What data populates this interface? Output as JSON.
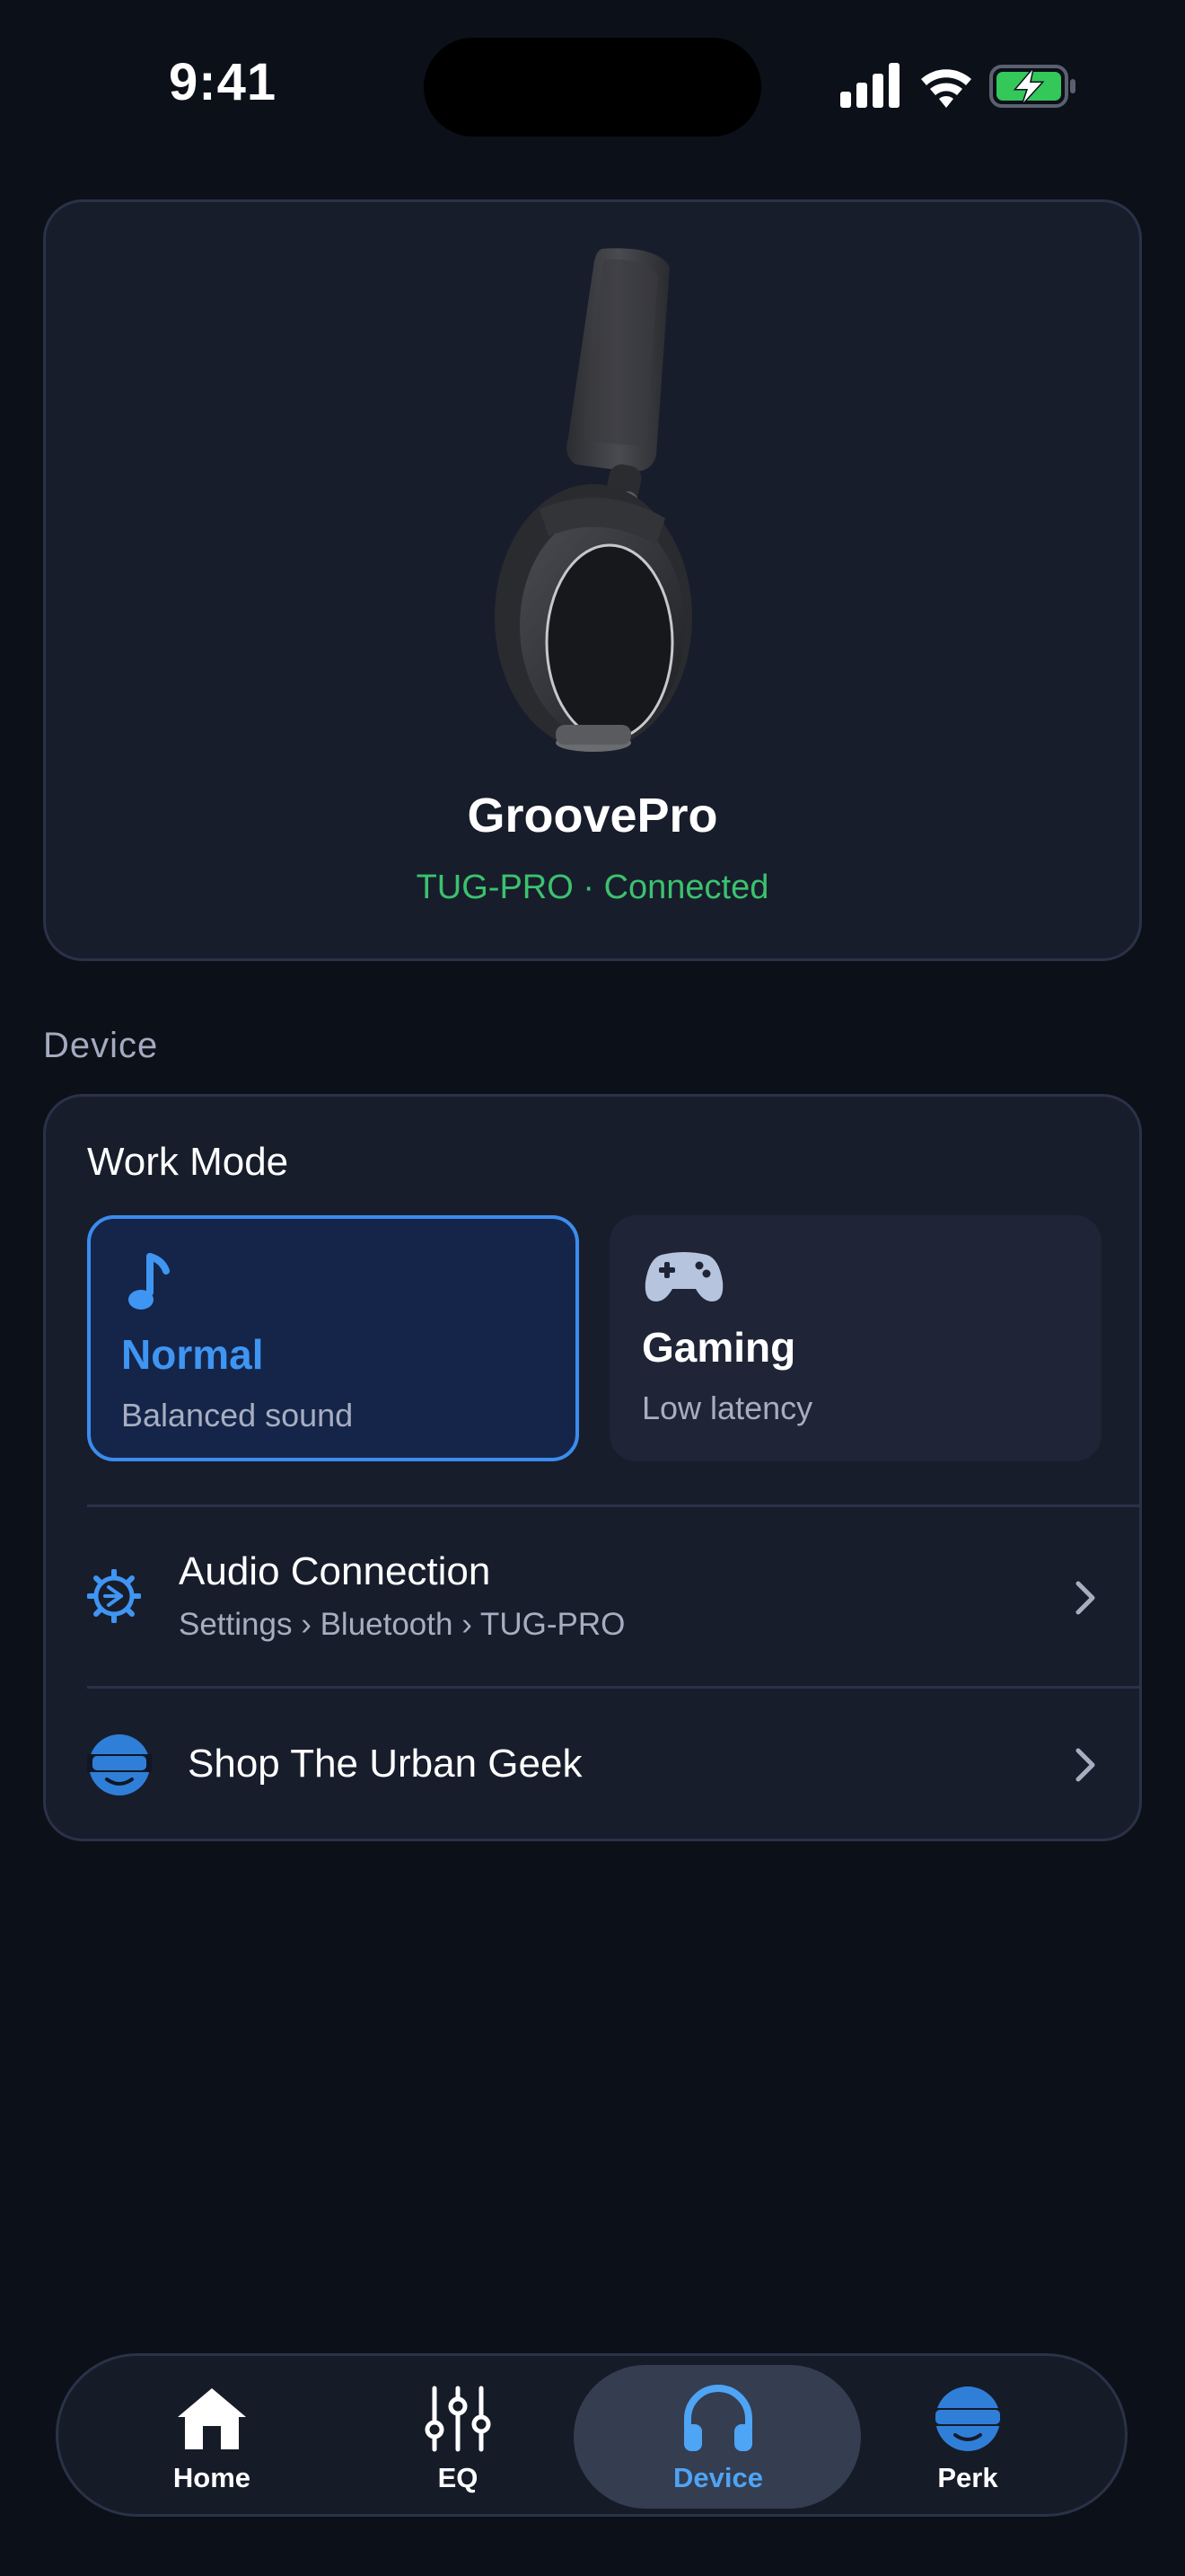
{
  "status_bar": {
    "time": "9:41",
    "icons": [
      "cellular-signal-icon",
      "wifi-icon",
      "battery-charging-icon"
    ]
  },
  "hero": {
    "image": "headphones-product-image",
    "device_name": "GroovePro",
    "connection_status": "TUG-PRO · Connected",
    "status_color": "#3bc26e"
  },
  "section": {
    "label": "Device"
  },
  "work_mode": {
    "title": "Work Mode",
    "modes": [
      {
        "title": "Normal",
        "subtitle": "Balanced sound",
        "icon": "music-note-icon",
        "selected": true
      },
      {
        "title": "Gaming",
        "subtitle": "Low latency",
        "icon": "gamepad-icon",
        "selected": false
      }
    ]
  },
  "audio_connection": {
    "title": "Audio Connection",
    "path": "Settings › Bluetooth › TUG-PRO",
    "icon": "connection-gear-icon"
  },
  "shop": {
    "title": "Shop The Urban Geek",
    "icon": "urban-geek-logo-icon"
  },
  "tabs": [
    {
      "label": "Home",
      "icon": "home-icon",
      "active": false
    },
    {
      "label": "EQ",
      "icon": "equalizer-sliders-icon",
      "active": false
    },
    {
      "label": "Device",
      "icon": "headphones-icon",
      "active": true
    },
    {
      "label": "Perk",
      "icon": "urban-geek-logo-icon",
      "active": false
    }
  ],
  "colors": {
    "background": "#0c1019",
    "card": "#181d2c",
    "accent": "#3b8ced",
    "connected": "#3bc26e"
  }
}
